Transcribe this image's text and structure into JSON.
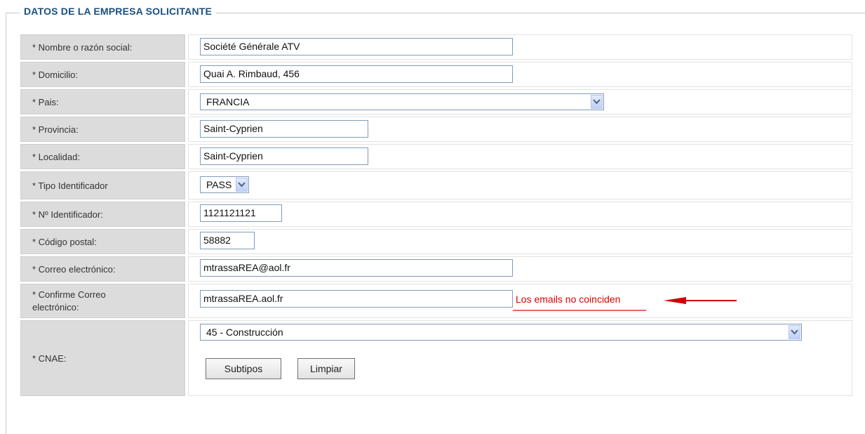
{
  "section": {
    "title": "DATOS DE LA EMPRESA SOLICITANTE"
  },
  "fields": {
    "nombre": {
      "label": "* Nombre o razón social:",
      "value": "Société Générale ATV"
    },
    "domicilio": {
      "label": "* Domicilio:",
      "value": "Quai A. Rimbaud, 456"
    },
    "pais": {
      "label": "* Pais:",
      "value": "FRANCIA"
    },
    "provincia": {
      "label": "* Provincia:",
      "value": "Saint-Cyprien"
    },
    "localidad": {
      "label": "* Localidad:",
      "value": "Saint-Cyprien"
    },
    "tipo_identificador": {
      "label": "* Tipo Identificador",
      "value": "PASS"
    },
    "num_identificador": {
      "label": "* Nº Identificador:",
      "value": "1121121121"
    },
    "codigo_postal": {
      "label": "* Código postal:",
      "value": "58882"
    },
    "correo": {
      "label": "* Correo electrónico:",
      "value": "mtrassaREA@aol.fr"
    },
    "confirme_correo": {
      "label_line1": "* Confirme Correo",
      "label_line2": "electrónico:",
      "value": "mtrassaREA.aol.fr",
      "error": "Los emails no coinciden"
    },
    "cnae": {
      "label": "* CNAE:",
      "value": "45 - Construcción"
    }
  },
  "buttons": {
    "subtipos": "Subtipos",
    "limpiar": "Limpiar"
  },
  "icons": {
    "dropdown": "chevron-down-icon",
    "arrow": "red-arrow-left-icon"
  },
  "colors": {
    "legend": "#1b4f7f",
    "error": "#e00000",
    "label_bg": "#dcdcdc"
  }
}
